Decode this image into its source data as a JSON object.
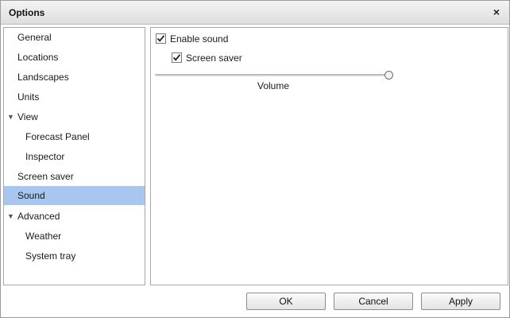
{
  "window": {
    "title": "Options",
    "close_label": "×"
  },
  "sidebar": {
    "items": [
      {
        "label": "General"
      },
      {
        "label": "Locations"
      },
      {
        "label": "Landscapes"
      },
      {
        "label": "Units"
      },
      {
        "label": "View",
        "expanded": true
      },
      {
        "label": "Forecast Panel"
      },
      {
        "label": "Inspector"
      },
      {
        "label": "Screen saver"
      },
      {
        "label": "Sound",
        "selected": true
      },
      {
        "label": "Advanced",
        "expanded": true
      },
      {
        "label": "Weather"
      },
      {
        "label": "System tray"
      }
    ],
    "expand_arrow": "▼"
  },
  "sound": {
    "enable_sound": {
      "label": "Enable sound",
      "checked": true
    },
    "screen_saver": {
      "label": "Screen saver",
      "checked": true
    },
    "volume": {
      "label": "Volume",
      "value_fraction": 1.0
    }
  },
  "buttons": {
    "ok": "OK",
    "cancel": "Cancel",
    "apply": "Apply"
  },
  "colors": {
    "selection": "#a9c6ef"
  }
}
